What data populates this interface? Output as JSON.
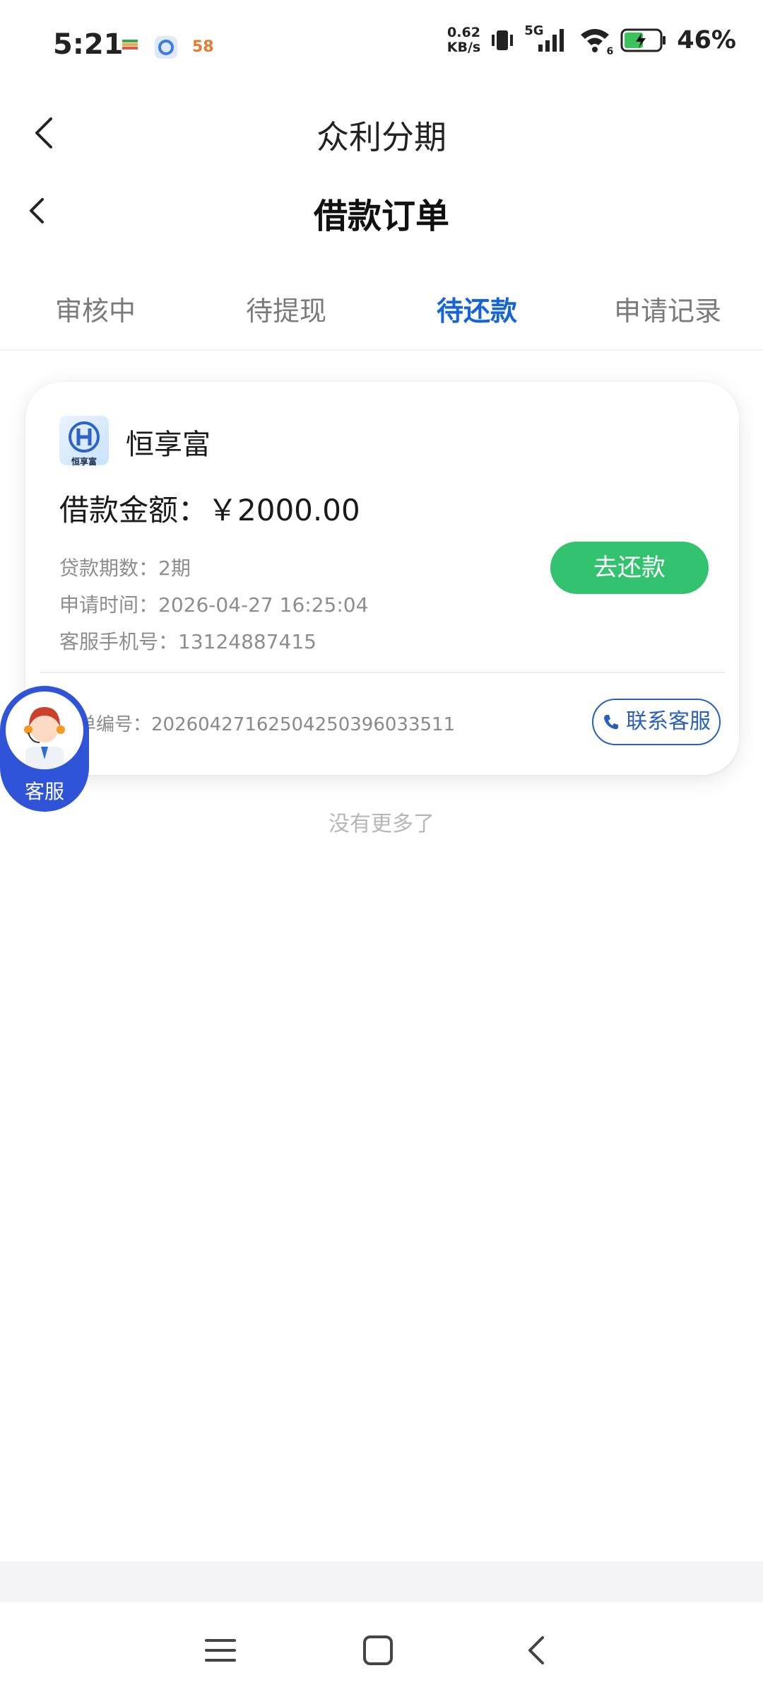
{
  "status_bar": {
    "time": "5:21",
    "net_speed_value": "0.62",
    "net_speed_unit": "KB/s",
    "network": "5G",
    "wifi_sub": "6",
    "battery_pct": "46%",
    "app_icons": [
      "wallet-app-icon",
      "browser-app-icon",
      "58-app-icon"
    ],
    "app_58_text": "58"
  },
  "header": {
    "app_title": "众利分期",
    "page_title": "借款订单"
  },
  "tabs": [
    {
      "label": "审核中",
      "active": false
    },
    {
      "label": "待提现",
      "active": false
    },
    {
      "label": "待还款",
      "active": true
    },
    {
      "label": "申请记录",
      "active": false
    }
  ],
  "order": {
    "lender_name": "恒享富",
    "logo_text": "恒享富",
    "amount_label": "借款金额：",
    "amount_value": "￥2000.00",
    "term_label": "贷款期数：",
    "term_value": "2期",
    "apply_time_label": "申请时间：",
    "apply_time_value": "2026-04-27 16:25:04",
    "phone_label": "客服手机号：",
    "phone_value": "13124887415",
    "order_no_label": "订单编号：",
    "order_no_value": "20260427162504250396033511",
    "repay_button": "去还款",
    "contact_button": "联系客服"
  },
  "floating_service": {
    "label": "客服"
  },
  "list_footer": "没有更多了",
  "colors": {
    "accent_blue": "#1565d8",
    "repay_green": "#33c26d",
    "service_blue": "#2f54d8"
  }
}
